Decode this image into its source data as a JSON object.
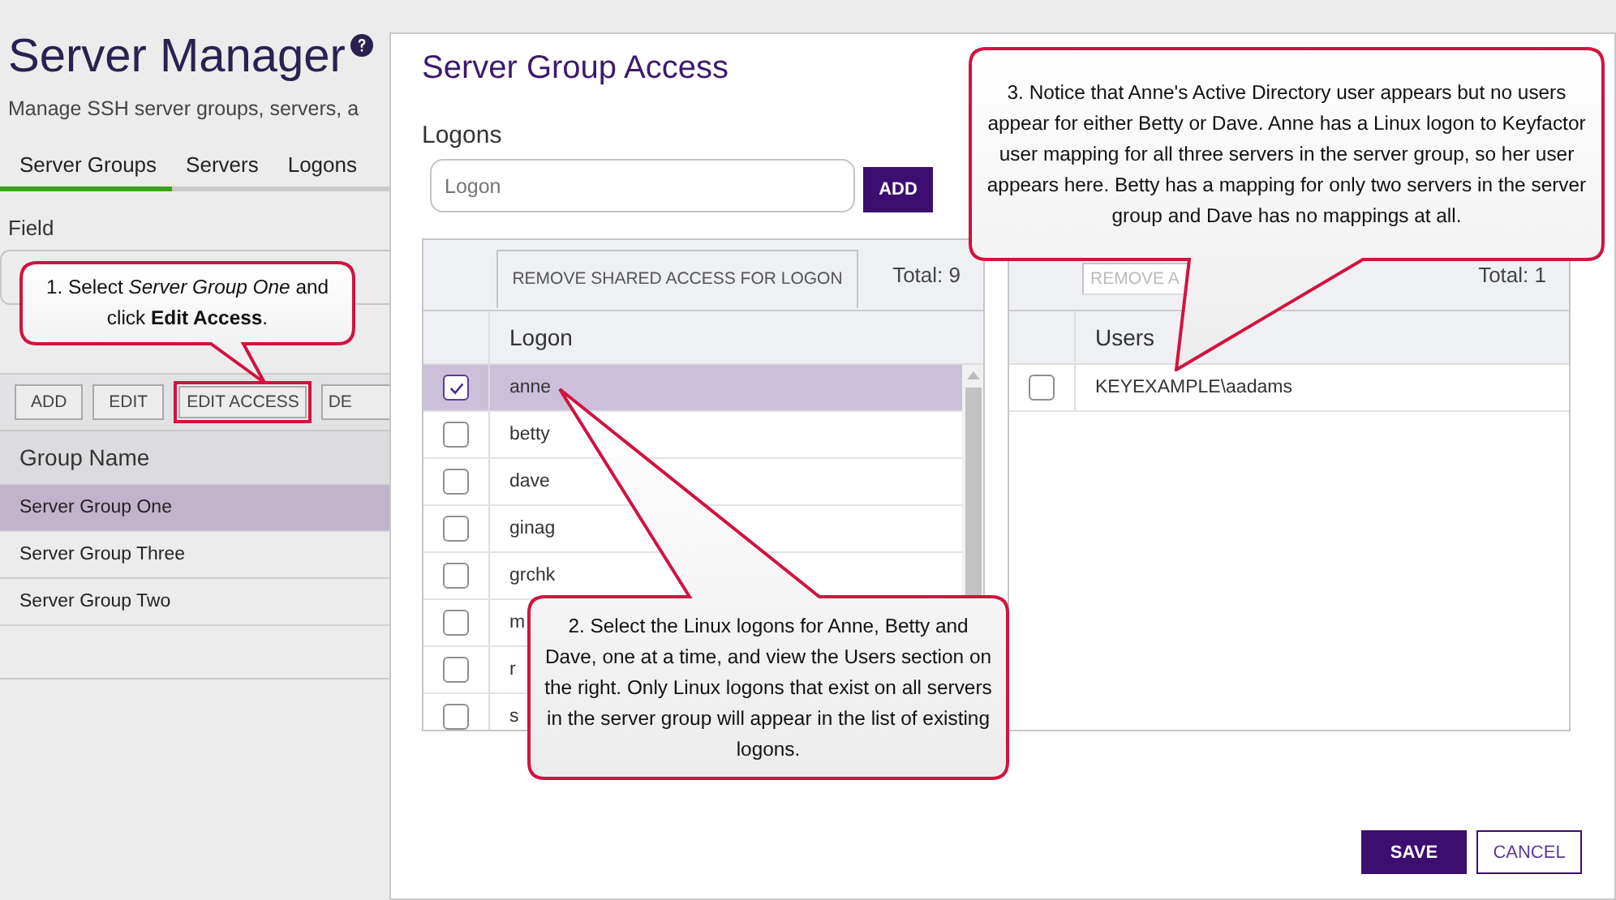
{
  "page": {
    "title": "Server Manager",
    "subtitle": "Manage SSH server groups, servers, a",
    "tabs": [
      {
        "label": "Server Groups",
        "selected": true
      },
      {
        "label": "Servers",
        "selected": false
      },
      {
        "label": "Logons",
        "selected": false
      }
    ],
    "field_label": "Field",
    "toolbar": [
      {
        "label": "ADD",
        "highlighted": false
      },
      {
        "label": "EDIT",
        "highlighted": false
      },
      {
        "label": "EDIT ACCESS",
        "highlighted": true
      },
      {
        "label": "DE",
        "highlighted": false
      }
    ],
    "table": {
      "columns": [
        "Group Name"
      ],
      "rows": [
        {
          "name": "Server Group One",
          "selected": true
        },
        {
          "name": "Server Group Three",
          "selected": false
        },
        {
          "name": "Server Group Two",
          "selected": false
        }
      ]
    }
  },
  "dialog": {
    "title": "Server Group Access",
    "section": "Logons",
    "logon_field": {
      "placeholder": "Logon"
    },
    "add_button": "ADD",
    "logons": {
      "action": "REMOVE SHARED ACCESS FOR LOGON",
      "total": "Total: 9",
      "column": "Logon",
      "rows": [
        {
          "name": "anne",
          "checked": true,
          "selected": true
        },
        {
          "name": "betty",
          "checked": false,
          "selected": false
        },
        {
          "name": "dave",
          "checked": false,
          "selected": false
        },
        {
          "name": "ginag",
          "checked": false,
          "selected": false
        },
        {
          "name": "grchk",
          "checked": false,
          "selected": false
        },
        {
          "name": "m",
          "checked": false,
          "selected": false
        },
        {
          "name": "r",
          "checked": false,
          "selected": false
        },
        {
          "name": "s",
          "checked": false,
          "selected": false
        }
      ]
    },
    "users": {
      "action": "REMOVE A",
      "total": "Total: 1",
      "column": "Users",
      "rows": [
        {
          "name": "KEYEXAMPLE\\aadams",
          "checked": false,
          "selected": false
        }
      ]
    },
    "buttons": [
      {
        "label": "SAVE",
        "kind": "primary"
      },
      {
        "label": "CANCEL",
        "kind": "secondary"
      }
    ]
  },
  "callouts": [
    {
      "text": "1. Select *Server Group One* and click **Edit Access**."
    },
    {
      "text": "2. Select the Linux logons for Anne, Betty and Dave, one at a time, and view the Users section on the right. Only Linux logons that exist on all servers in the server group will appear in the list of existing logons."
    },
    {
      "text": "3. Notice that Anne's Active Directory user appears but no users appear for either Betty or Dave. Anne has a Linux logon to Keyfactor user mapping for all three servers in the server group, so her user appears here. Betty has a mapping for only two servers in the server group and Dave has no mappings at all."
    }
  ]
}
